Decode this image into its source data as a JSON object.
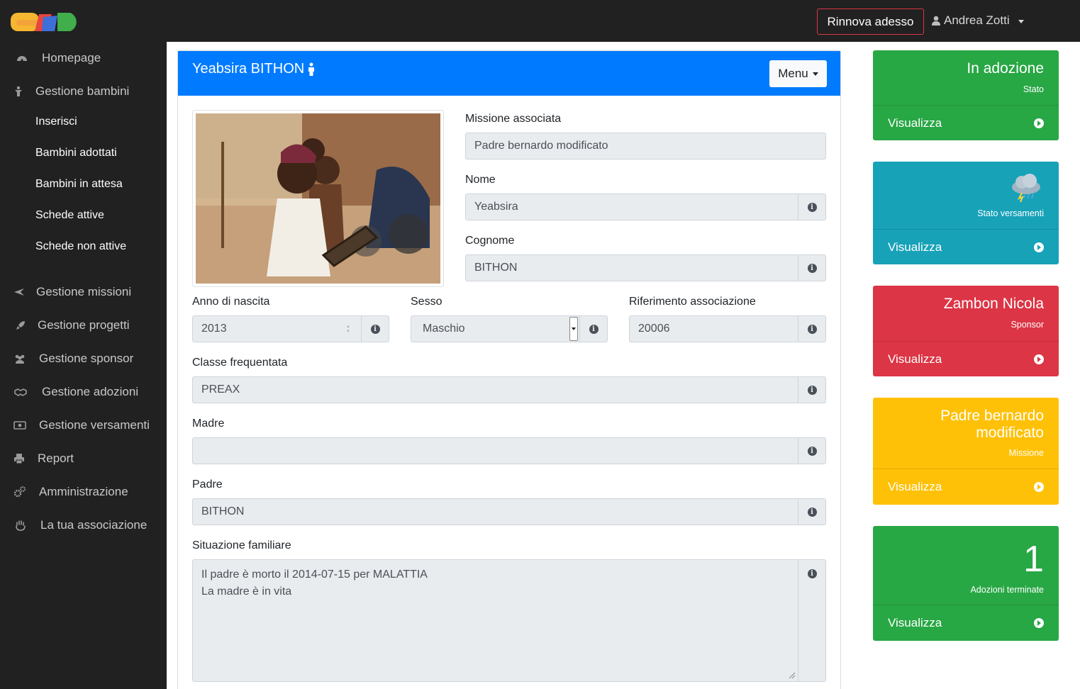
{
  "topbar": {
    "renew_label": "Rinnova adesso",
    "user_name": "Andrea Zotti"
  },
  "sidebar": {
    "items": [
      {
        "label": "Homepage",
        "icon": "dashboard-icon"
      },
      {
        "label": "Gestione bambini",
        "icon": "child-icon"
      },
      {
        "label": "Gestione missioni",
        "icon": "plane-icon"
      },
      {
        "label": "Gestione progetti",
        "icon": "rocket-icon"
      },
      {
        "label": "Gestione sponsor",
        "icon": "users-icon"
      },
      {
        "label": "Gestione adozioni",
        "icon": "handshake-icon"
      },
      {
        "label": "Gestione versamenti",
        "icon": "money-icon"
      },
      {
        "label": "Report",
        "icon": "print-icon"
      },
      {
        "label": "Amministrazione",
        "icon": "cogs-icon"
      },
      {
        "label": "La tua associazione",
        "icon": "hand-icon"
      }
    ],
    "subitems": [
      "Inserisci",
      "Bambini adottati",
      "Bambini in attesa",
      "Schede attive",
      "Schede non attive"
    ]
  },
  "card": {
    "title": "Yeabsira BITHON",
    "menu_label": "Menu"
  },
  "form": {
    "mission_label": "Missione associata",
    "mission_value": "Padre bernardo modificato",
    "name_label": "Nome",
    "name_value": "Yeabsira",
    "surname_label": "Cognome",
    "surname_value": "BITHON",
    "birth_year_label": "Anno di nascita",
    "birth_year_value": "2013",
    "sex_label": "Sesso",
    "sex_value": "Maschio",
    "ref_label": "Riferimento associazione",
    "ref_value": "20006",
    "class_label": "Classe frequentata",
    "class_value": "PREAX",
    "mother_label": "Madre",
    "mother_value": "",
    "father_label": "Padre",
    "father_value": "BITHON",
    "family_label": "Situazione familiare",
    "family_value": "Il padre è morto il 2014-07-15 per MALATTIA\nLa madre è in vita"
  },
  "widgets": [
    {
      "title": "In adozione",
      "subtitle": "Stato",
      "footer": "Visualizza",
      "color": "#28a745"
    },
    {
      "title": "",
      "subtitle": "Stato versamenti",
      "footer": "Visualizza",
      "color": "#17a2b8",
      "icon": "storm-cloud-icon"
    },
    {
      "title": "Zambon Nicola",
      "subtitle": "Sponsor",
      "footer": "Visualizza",
      "color": "#dc3545"
    },
    {
      "title": "Padre bernardo modificato",
      "subtitle": "Missione",
      "footer": "Visualizza",
      "color": "#ffc107"
    },
    {
      "title": "1",
      "subtitle": "Adozioni terminate",
      "footer": "Visualizza",
      "color": "#28a745"
    }
  ]
}
